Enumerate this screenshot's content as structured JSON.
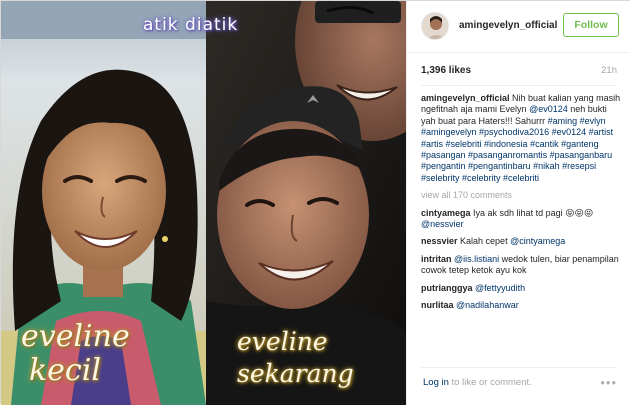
{
  "photo": {
    "overlay_title": "atik diatik",
    "caption_left_line1": "eveline",
    "caption_left_line2": "kecil",
    "caption_right_line1": "eveline",
    "caption_right_line2": "sekarang"
  },
  "header": {
    "username": "amingevelyn_official",
    "follow_label": "Follow",
    "avatar_icon": "profile-avatar"
  },
  "stats": {
    "likes": "1,396 likes",
    "time": "21h"
  },
  "caption": {
    "user": "amingevelyn_official",
    "text_1": " Nih buat kalian yang masih ngefitnah aja mami Evelyn ",
    "mention": "@ev0124",
    "text_2": " neh bukti yah buat para Haters!!! Sahurrr ",
    "hashtags": "#aming #evlyn #amingevelyn #psychodiva2016 #ev0124 #artist #artis #selebriti #indonesia #cantik #ganteng #pasangan #pasanganromantis #pasanganbaru #pengantin #pengantinbaru #nikah #resepsi #selebrity #celebrity #celebriti"
  },
  "view_all": "view all 170 comments",
  "comments": [
    {
      "user": "cintyamega",
      "text": " Iya ak sdh lihat td pagi 😝😝😝 ",
      "mention": "@nessvier"
    },
    {
      "user": "nessvier",
      "text": " Kalah cepet ",
      "mention": "@cintyamega"
    },
    {
      "user": "intritan",
      "text_pre": " ",
      "mention": "@iis.listiani",
      "text": " wedok tulen, biar penampilan cowok tetep ketok ayu kok"
    },
    {
      "user": "putrianggya",
      "text_pre": " ",
      "mention": "@fettyyudith",
      "text": ""
    },
    {
      "user": "nurlitaa",
      "text_pre": " ",
      "mention": "@nadilahanwar",
      "text": ""
    }
  ],
  "footer": {
    "login_link": "Log in",
    "login_rest": " to like or comment.",
    "more_icon": "more-options"
  },
  "colors": {
    "follow_green": "#70c050",
    "link_blue": "#003569",
    "muted_grey": "#a5a7aa"
  }
}
